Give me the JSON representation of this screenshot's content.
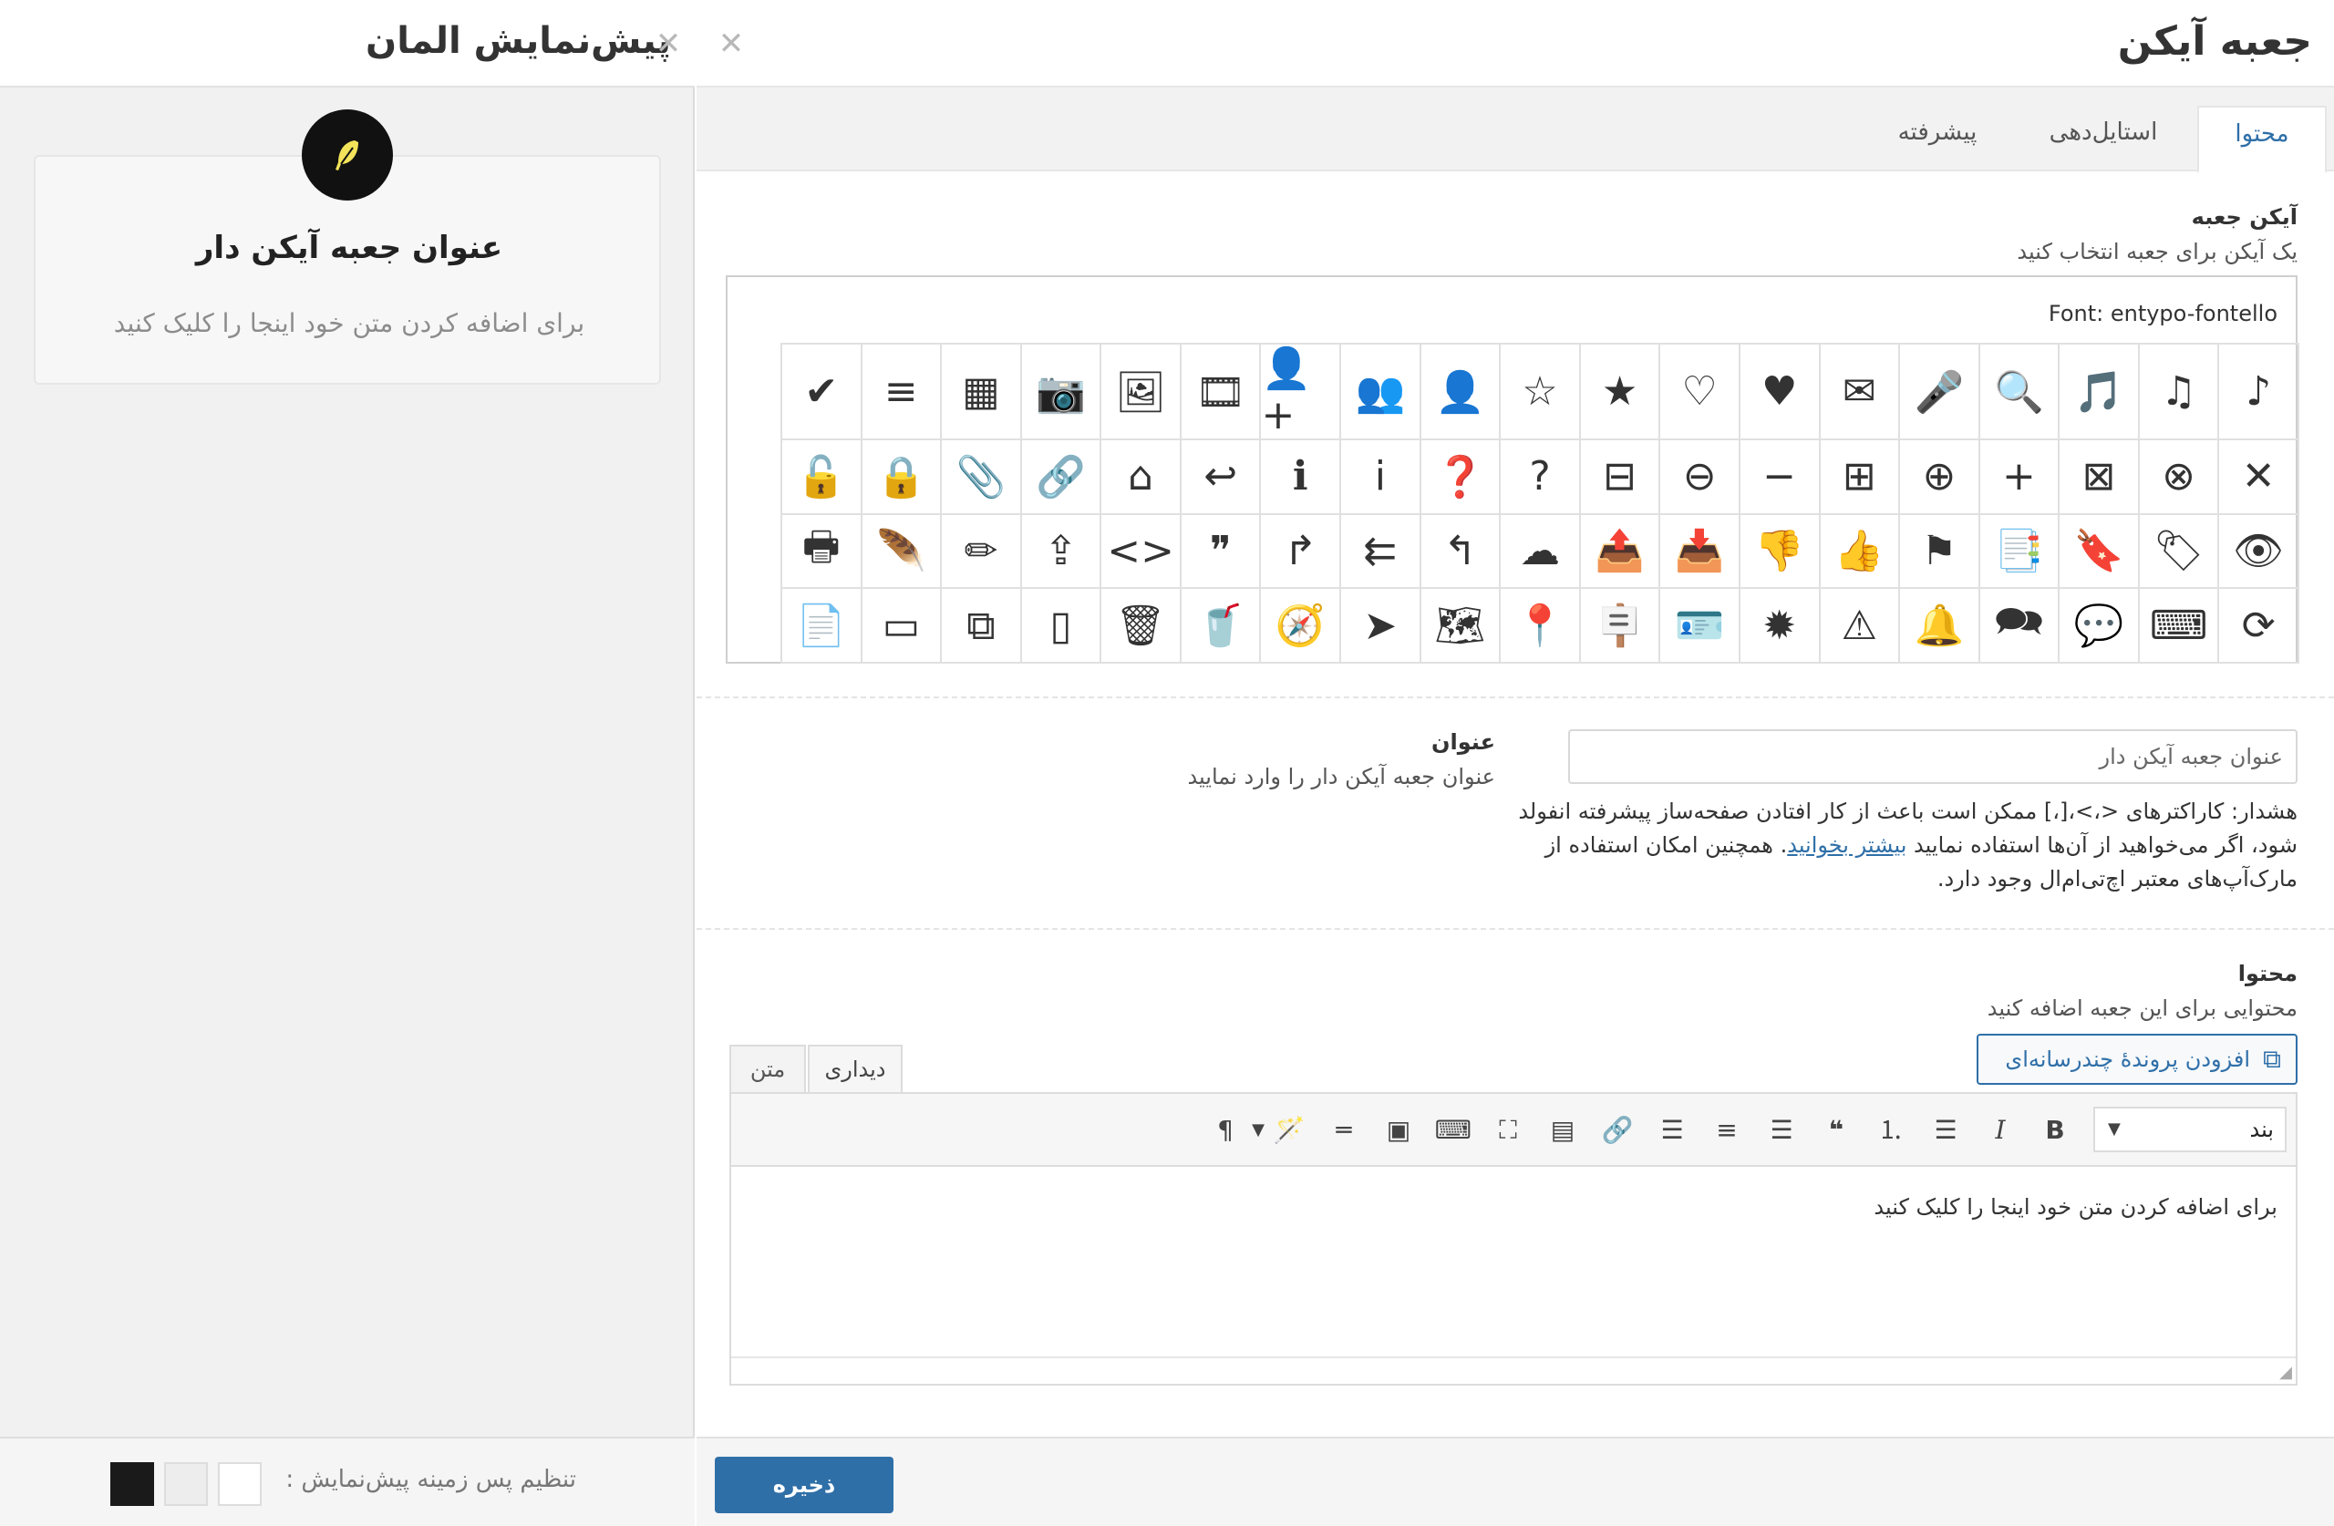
{
  "preview": {
    "title": "پیش‌نمایش المان",
    "close_glyph": "✕",
    "box_icon": "🪶",
    "box_title": "عنوان جعبه آیکن دار",
    "box_text": "برای اضافه کردن متن خود اینجا را کلیک کنید",
    "background_label": "تنظیم پس زمینه پیش‌نمایش :"
  },
  "settings": {
    "title": "جعبه آیکن",
    "close_glyph": "✕",
    "tabs": [
      {
        "label": "محتوا",
        "active": true
      },
      {
        "label": "استایل‌دهی",
        "active": false
      },
      {
        "label": "پیشرفته",
        "active": false
      }
    ],
    "icon_field": {
      "label": "آیکن جعبه",
      "description": "یک آیکن برای جعبه انتخاب کنید",
      "font": "Font: entypo-fontello",
      "selected_icon": "feather-icon",
      "icons": [
        "♪",
        "♫",
        "🎵",
        "🔍",
        "🎤",
        "✉",
        "♥",
        "♡",
        "★",
        "☆",
        "👤",
        "👥",
        "👤+",
        "🎞",
        "🖼",
        "📷",
        "▦",
        "≡",
        "✔",
        "✕",
        "⊗",
        "⊠",
        "+",
        "⊕",
        "⊞",
        "−",
        "⊖",
        "⊟",
        "?",
        "❓",
        "i",
        "ℹ",
        "↩",
        "⌂",
        "🔗",
        "📎",
        "🔒",
        "🔓",
        "👁",
        "🏷",
        "🔖",
        "📑",
        "⚑",
        "👍",
        "👎",
        "📥",
        "📤",
        "☁",
        "↰",
        "⇇",
        "↱",
        "❞",
        "<>",
        "⇪",
        "✏",
        "🪶",
        "🖶",
        "⟳",
        "⌨",
        "💬",
        "🗪",
        "🔔",
        "⚠",
        "✹",
        "🪪",
        "🪧",
        "📍",
        "🗺",
        "➤",
        "🧭",
        "🥤",
        "🗑",
        "▯",
        "⧉",
        "▭",
        "📄"
      ]
    },
    "title_field": {
      "label": "عنوان",
      "description": "عنوان جعبه آیکن دار را وارد نمایید",
      "value": "عنوان جعبه آیکن دار",
      "warning_before": "هشدار: کاراکترهای <،>،[،] ممکن است باعث از کار افتادن صفحه‌ساز پیشرفته انفولد شود، اگر می‌خواهید از آن‌ها استفاده نمایید ",
      "warning_link": "بیشتر بخوانید",
      "warning_after": ". همچنین امکان استفاده از مارک‌آپ‌های معتبر اچ‌تی‌ام‌ال وجود دارد."
    },
    "content_field": {
      "label": "محتوا",
      "description": "محتوایی برای این جعبه اضافه کنید",
      "add_media": "افزودن پروندهٔ چندرسانه‌ای",
      "editor_tabs": {
        "visual": "دیداری",
        "text": "متن"
      },
      "format_value": "بند",
      "body_text": "برای اضافه کردن متن خود اینجا را کلیک کنید"
    },
    "save_label": "ذخیره"
  },
  "colors": {
    "accent": "#2f6fa8",
    "preview_background": "#f1f1f1",
    "icon_circle": "#111111",
    "icon_symbol": "#f3e35a",
    "selected_icon": "#d35a2a",
    "swatches": [
      "#1a1a1a",
      "#ededed",
      "#ffffff"
    ]
  }
}
